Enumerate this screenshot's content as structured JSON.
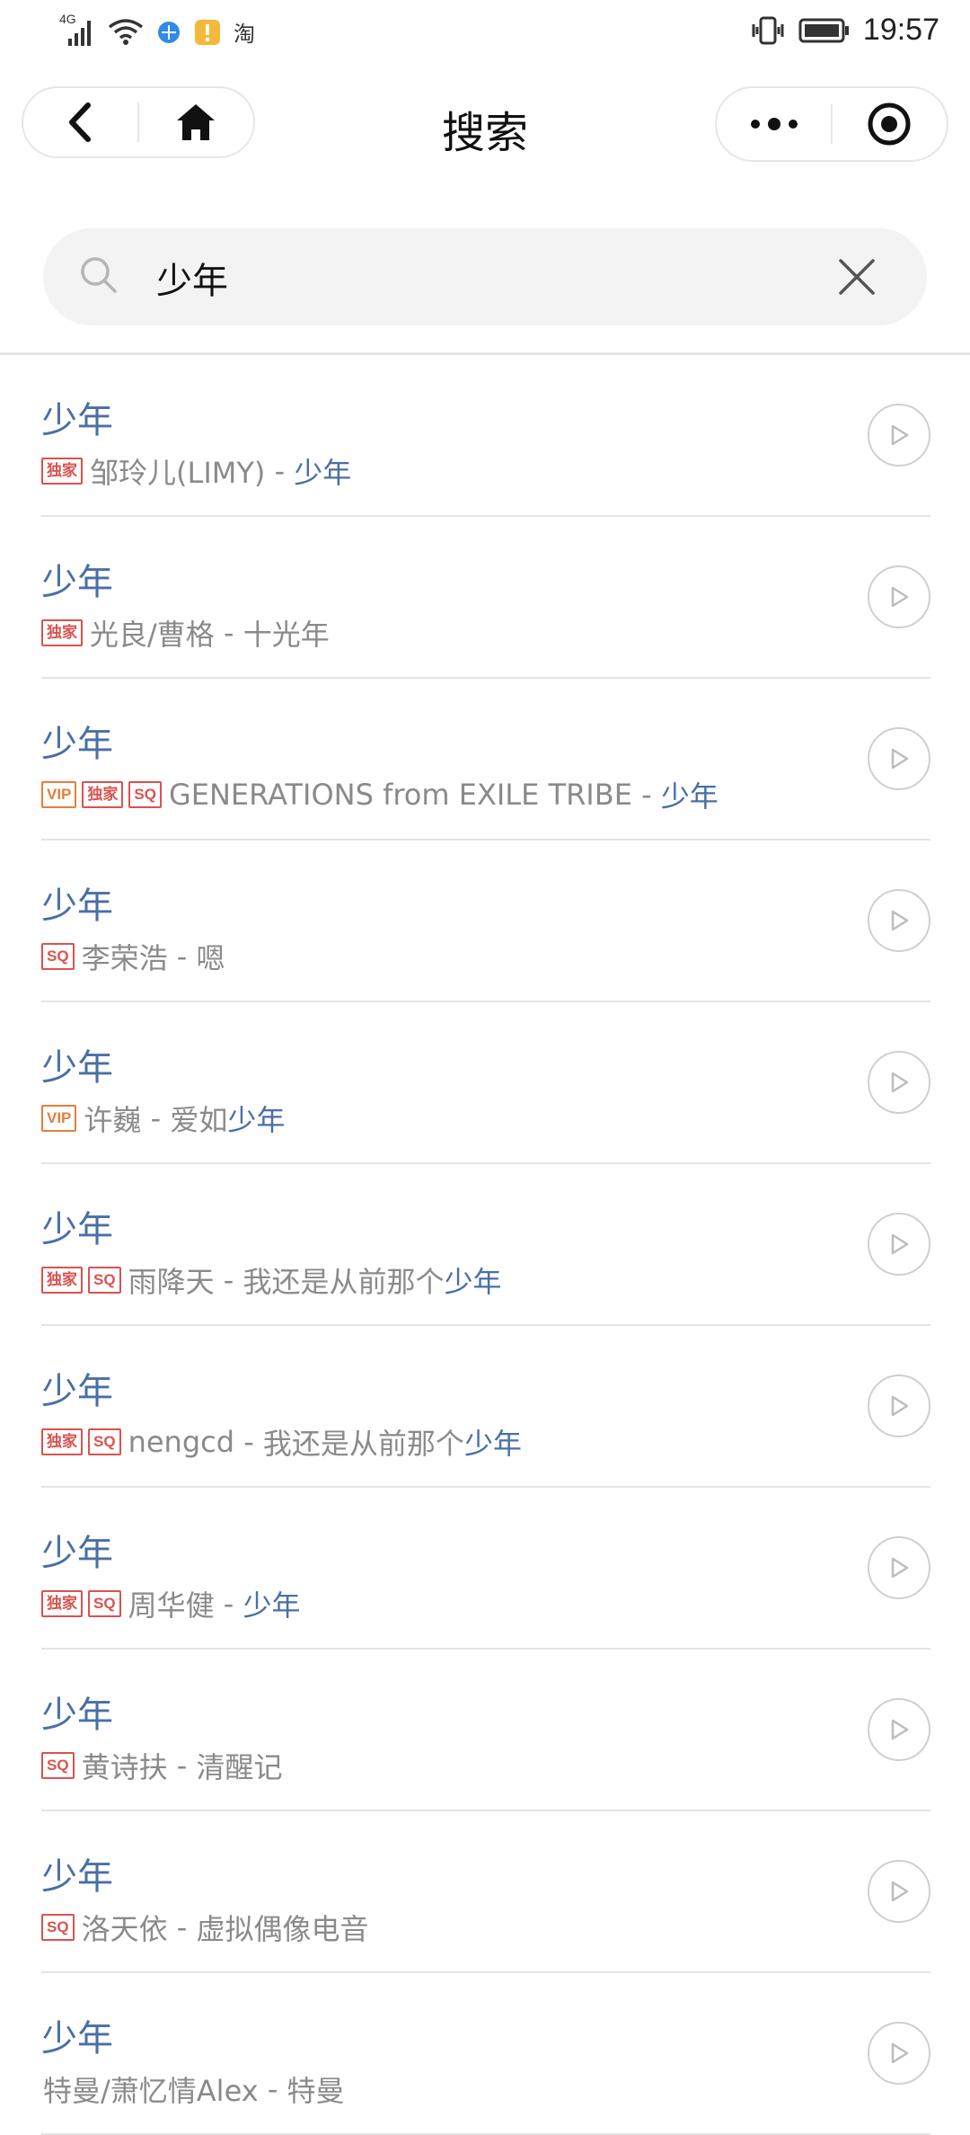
{
  "status_bar": {
    "network": "4G",
    "taobao_label": "淘",
    "time": "19:57"
  },
  "nav": {
    "title": "搜索"
  },
  "search": {
    "value": "少年",
    "placeholder": ""
  },
  "colors": {
    "link_blue": "#4a6fa5",
    "badge_red": "#d9534f",
    "badge_vip": "#e67e3c",
    "gray_text": "#8a8a8a"
  },
  "results": [
    {
      "title": "少年",
      "badges": [
        "独家"
      ],
      "artist": "邹玲儿(LIMY)",
      "sep": " - ",
      "album_pre": "",
      "album_hl": "少年"
    },
    {
      "title": "少年",
      "badges": [
        "独家"
      ],
      "artist": "光良/曹格",
      "sep": " - ",
      "album_pre": "十光年",
      "album_hl": ""
    },
    {
      "title": "少年",
      "badges": [
        "VIP",
        "独家",
        "SQ"
      ],
      "artist": "GENERATIONS from EXILE TRIBE",
      "sep": " - ",
      "album_pre": "",
      "album_hl": "少年"
    },
    {
      "title": "少年",
      "badges": [
        "SQ"
      ],
      "artist": "李荣浩",
      "sep": " - ",
      "album_pre": "嗯",
      "album_hl": ""
    },
    {
      "title": "少年",
      "badges": [
        "VIP"
      ],
      "artist": "许巍",
      "sep": " - ",
      "album_pre": "爱如",
      "album_hl": "少年"
    },
    {
      "title": "少年",
      "badges": [
        "独家",
        "SQ"
      ],
      "artist": "雨降天",
      "sep": " - ",
      "album_pre": "我还是从前那个",
      "album_hl": "少年"
    },
    {
      "title": "少年",
      "badges": [
        "独家",
        "SQ"
      ],
      "artist": "nengcd",
      "sep": " - ",
      "album_pre": "我还是从前那个",
      "album_hl": "少年"
    },
    {
      "title": "少年",
      "badges": [
        "独家",
        "SQ"
      ],
      "artist": "周华健",
      "sep": " - ",
      "album_pre": "",
      "album_hl": "少年"
    },
    {
      "title": "少年",
      "badges": [
        "SQ"
      ],
      "artist": "黄诗扶",
      "sep": " - ",
      "album_pre": "清醒记",
      "album_hl": ""
    },
    {
      "title": "少年",
      "badges": [
        "SQ"
      ],
      "artist": "洛天依",
      "sep": " - ",
      "album_pre": "虚拟偶像电音",
      "album_hl": ""
    },
    {
      "title": "少年",
      "badges": [],
      "artist": "特曼/萧忆情Alex",
      "sep": " - ",
      "album_pre": "特曼",
      "album_hl": ""
    }
  ]
}
